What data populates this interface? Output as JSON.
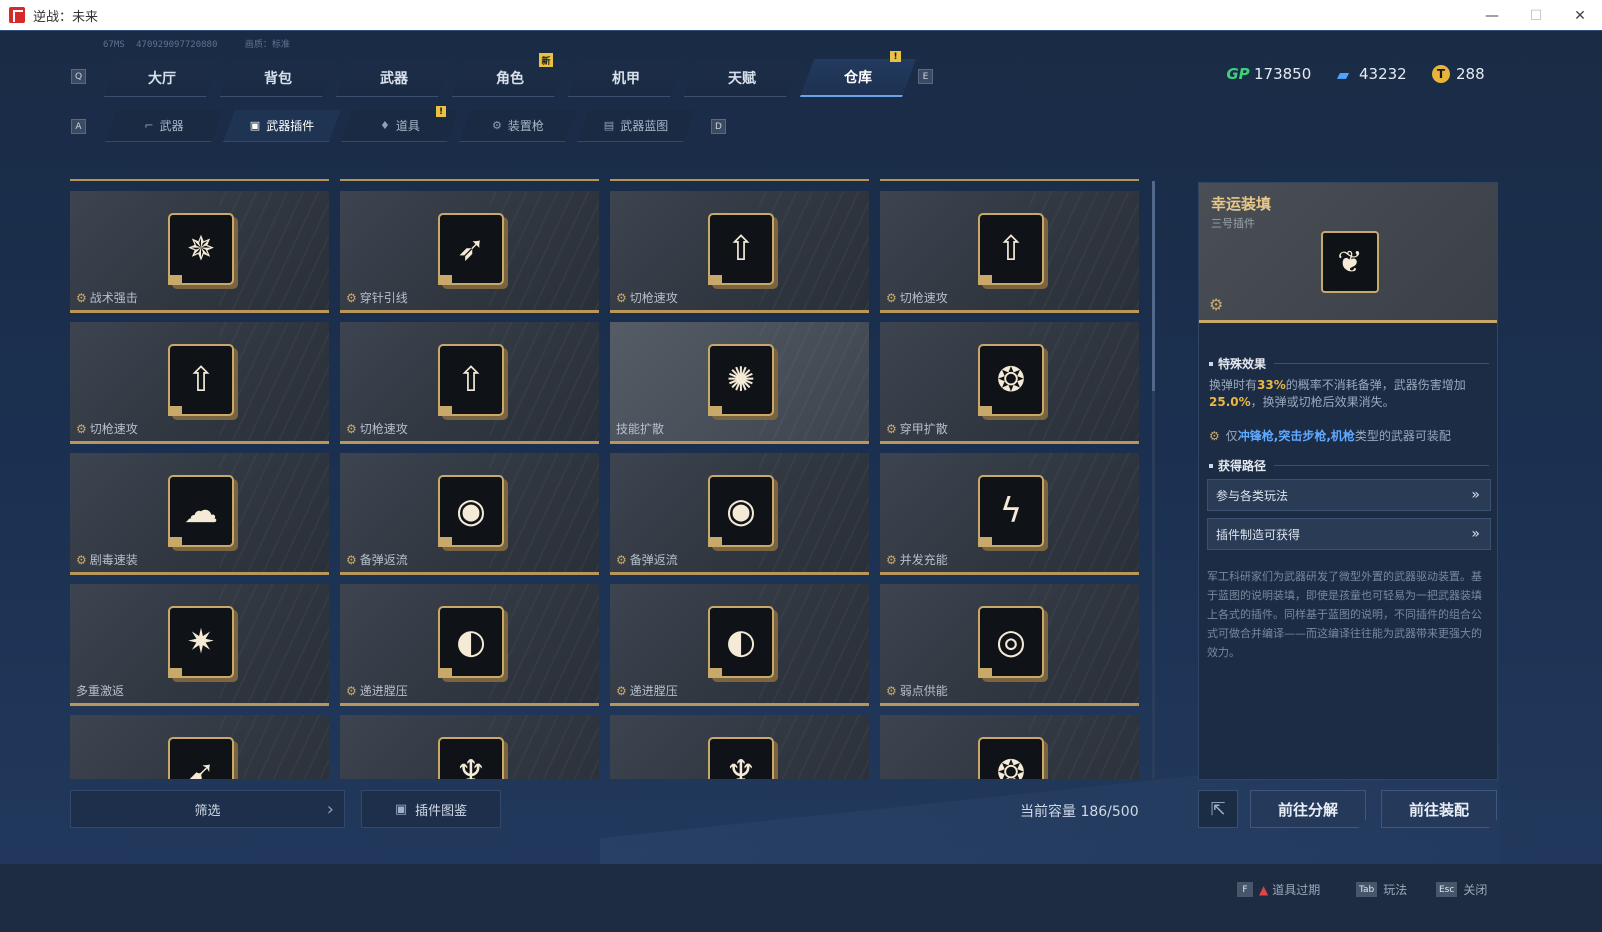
{
  "window": {
    "title": "逆战：未来",
    "minimize": "—",
    "maximize": "☐",
    "close": "✕"
  },
  "meta": {
    "ping": "67MS",
    "uid": "470929097720880",
    "quality": "画质：标准"
  },
  "tabs": [
    {
      "label": "大厅"
    },
    {
      "label": "背包"
    },
    {
      "label": "武器"
    },
    {
      "label": "角色"
    },
    {
      "label": "机甲"
    },
    {
      "label": "天赋"
    },
    {
      "label": "仓库"
    }
  ],
  "badges": {
    "new": "新",
    "alert": "!"
  },
  "keys": {
    "q": "Q",
    "e": "E",
    "a": "A",
    "d": "D"
  },
  "currency": [
    {
      "icon": "gp-icon",
      "glyph": "GP",
      "value": "173850",
      "color": "#3fd07a"
    },
    {
      "icon": "ticket-icon",
      "glyph": "▰",
      "value": "43232",
      "color": "#4fa4ff"
    },
    {
      "icon": "coin-icon",
      "glyph": "T",
      "value": "288",
      "color": "#e8b43a"
    }
  ],
  "subtabs": [
    {
      "label": "武器"
    },
    {
      "label": "武器插件"
    },
    {
      "label": "道具"
    },
    {
      "label": "装置枪"
    },
    {
      "label": "武器蓝图"
    }
  ],
  "items": [
    {
      "name": "战术强击",
      "glyph": "✵"
    },
    {
      "name": "穿针引线",
      "glyph": "➶"
    },
    {
      "name": "切枪速攻",
      "glyph": "⇧"
    },
    {
      "name": "切枪速攻",
      "glyph": "⇧"
    },
    {
      "name": "切枪速攻",
      "glyph": "⇧"
    },
    {
      "name": "切枪速攻",
      "glyph": "⇧"
    },
    {
      "name": "技能扩散",
      "glyph": "✺"
    },
    {
      "name": "穿甲扩散",
      "glyph": "❂"
    },
    {
      "name": "剧毒速装",
      "glyph": "☁"
    },
    {
      "name": "备弹返流",
      "glyph": "◉"
    },
    {
      "name": "备弹返流",
      "glyph": "◉"
    },
    {
      "name": "并发充能",
      "glyph": "ϟ"
    },
    {
      "name": "多重激返",
      "glyph": "✷"
    },
    {
      "name": "递进膛压",
      "glyph": "◐"
    },
    {
      "name": "递进膛压",
      "glyph": "◐"
    },
    {
      "name": "弱点供能",
      "glyph": "◎"
    },
    {
      "name": "",
      "glyph": "➹"
    },
    {
      "name": "",
      "glyph": "♆"
    },
    {
      "name": "",
      "glyph": "♆"
    },
    {
      "name": "",
      "glyph": "❂"
    }
  ],
  "filter": {
    "label": "筛选"
  },
  "codex": {
    "label": "插件图鉴"
  },
  "capacity": "当前容量 186/500",
  "detail": {
    "title": "幸运装填",
    "subtitle": "三号插件",
    "glyph": "❦",
    "special_title": "特殊效果",
    "effect_a": "换弹时有",
    "effect_pct1": "33%",
    "effect_b": "的概率不消耗备弹，武器伤害增加",
    "effect_pct2": "25.0%",
    "effect_c": "，换弹或切枪后效果消失。",
    "compat_prefix": "仅",
    "compat_types": "冲锋枪,突击步枪,机枪",
    "compat_suffix": "类型的武器可装配",
    "route_title": "获得路径",
    "routes": [
      {
        "label": "参与各类玩法"
      },
      {
        "label": "插件制造可获得"
      }
    ],
    "description": "军工科研家们为武器研发了微型外置的武器驱动装置。基于蓝图的说明装填，即使是孩童也可轻易为一把武器装填上各式的插件。同样基于蓝图的说明，不同插件的组合公式可做合并编译——而这编译往往能为武器带来更强大的效力。"
  },
  "actions": {
    "decompose": "前往分解",
    "equip": "前往装配"
  },
  "footer": [
    {
      "key": "F",
      "label": "道具过期"
    },
    {
      "key": "Tab",
      "label": "玩法"
    },
    {
      "key": "Esc",
      "label": "关闭"
    }
  ]
}
